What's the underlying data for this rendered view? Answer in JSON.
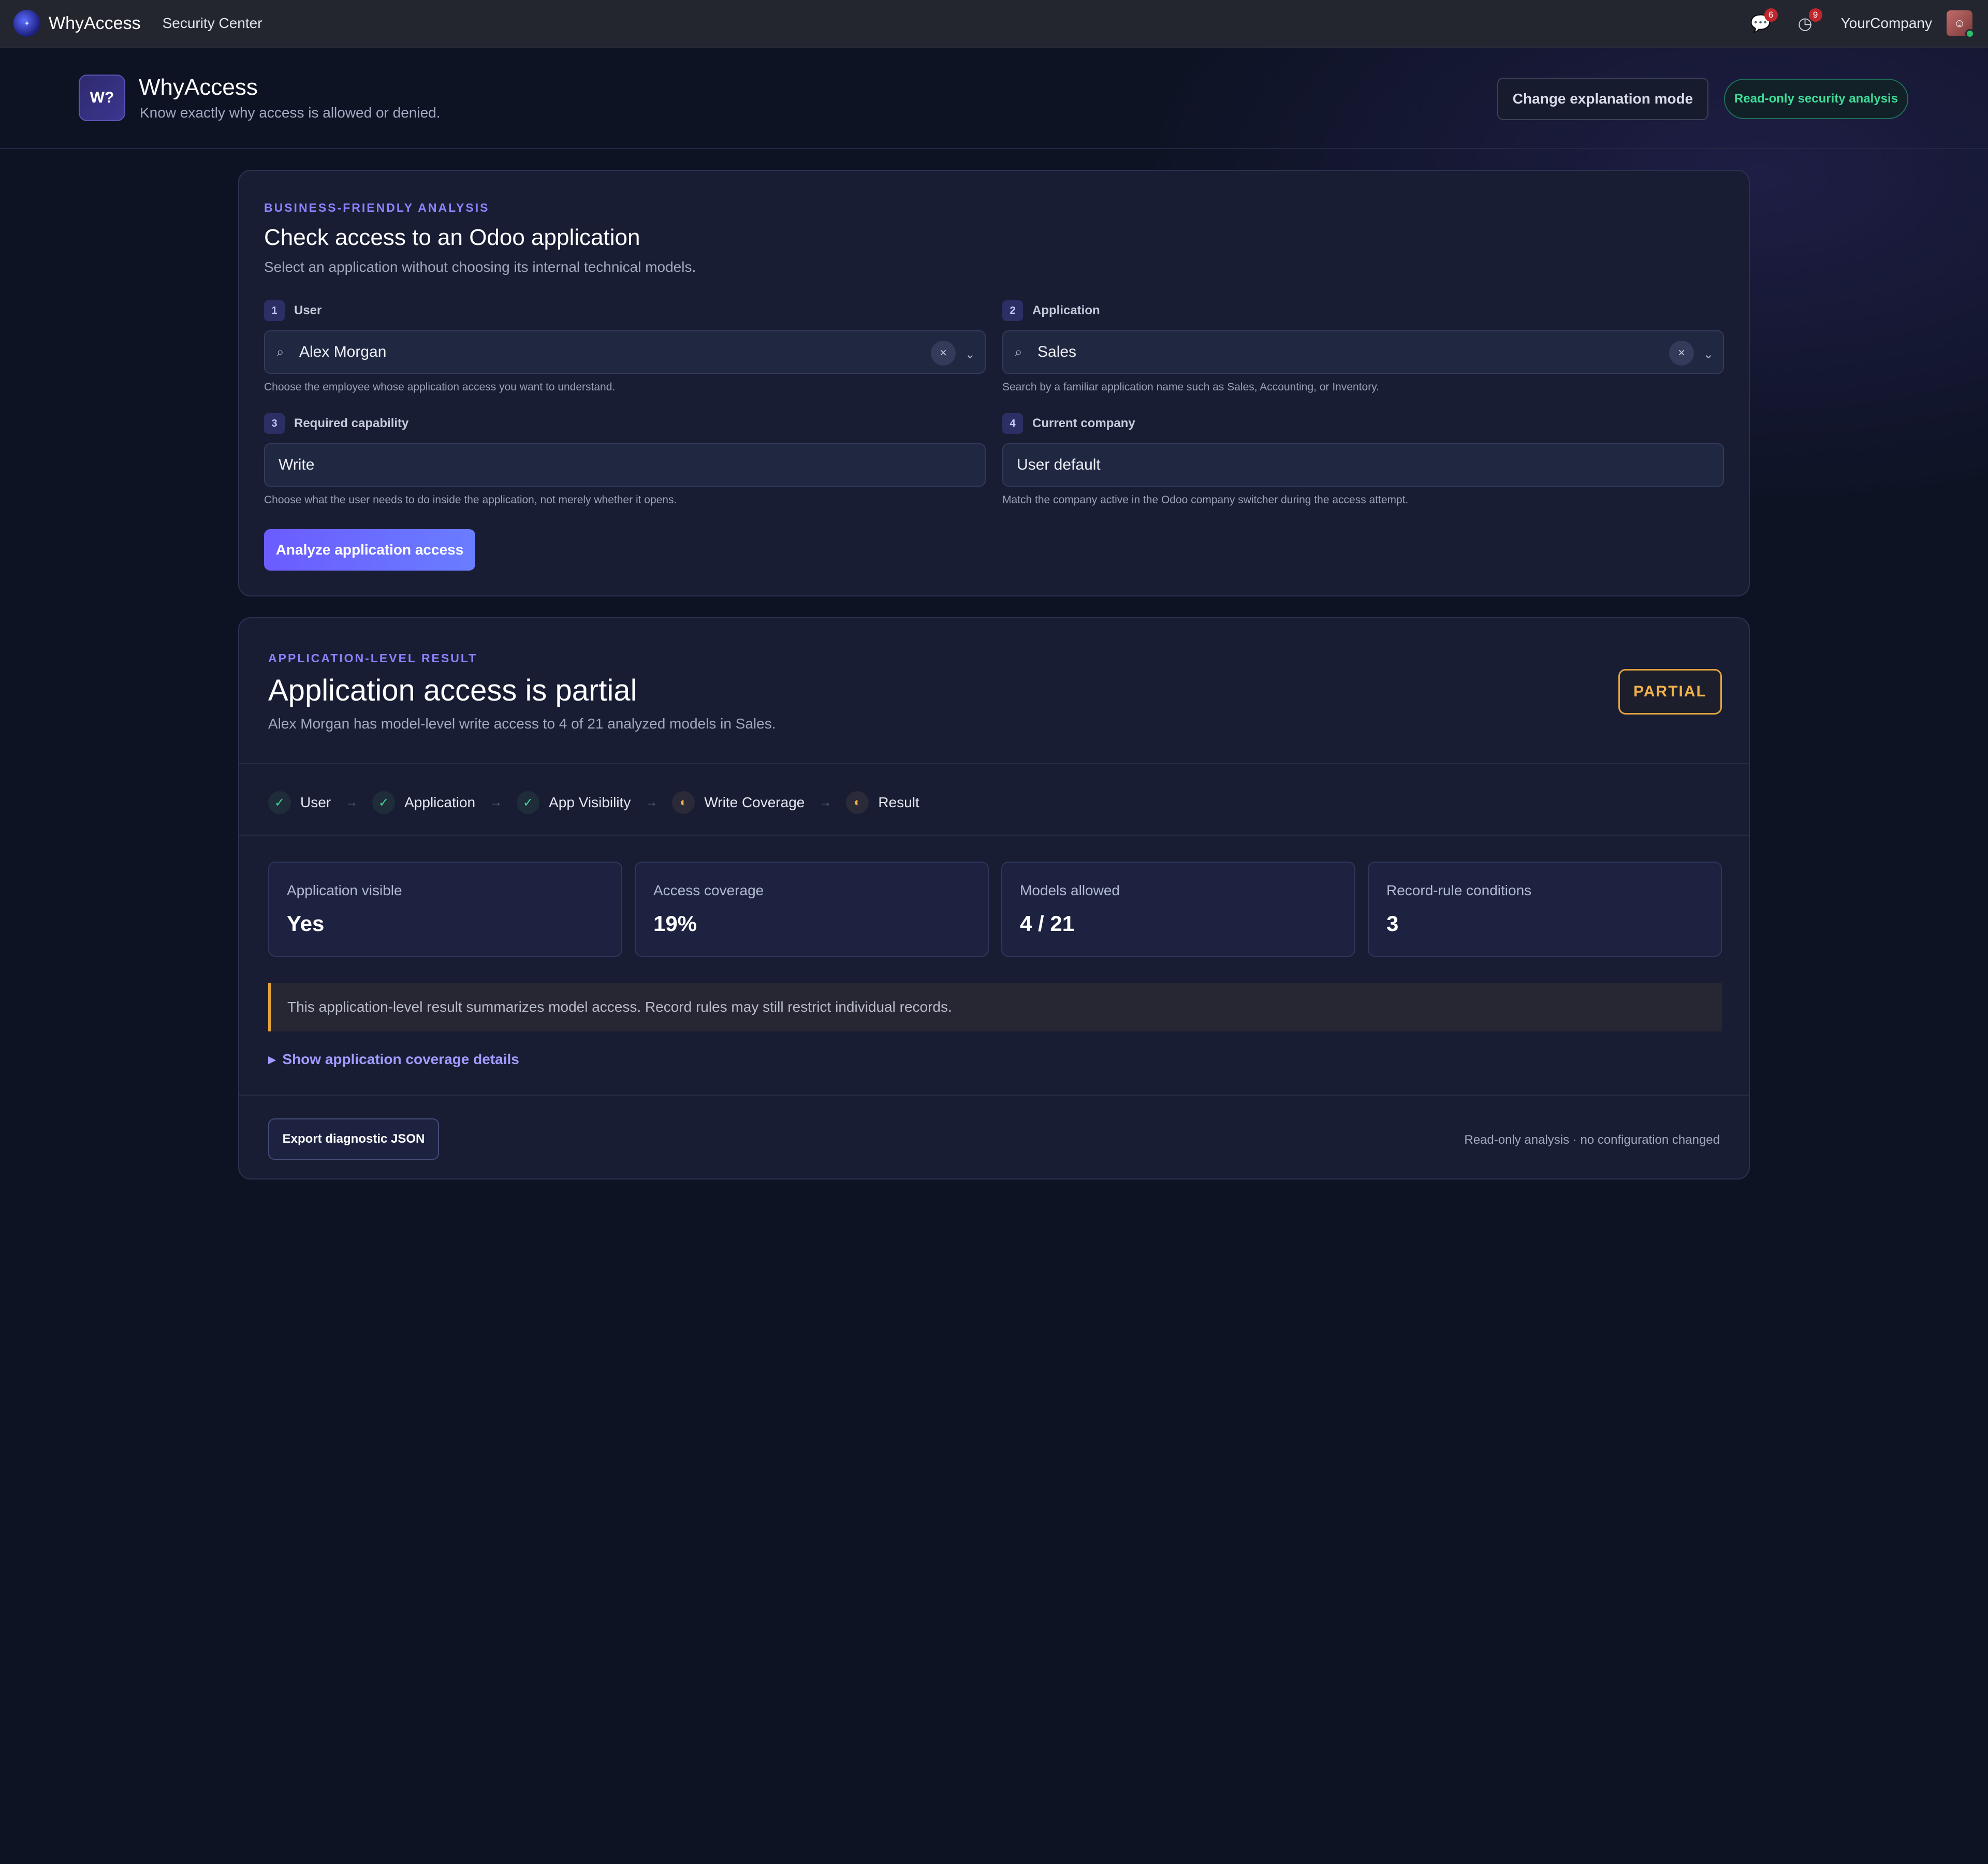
{
  "navbar": {
    "brand": "WhyAccess",
    "menu_item": "Security Center",
    "messages_count": "6",
    "activities_count": "9",
    "company": "YourCompany"
  },
  "header": {
    "logo_text": "W?",
    "title": "WhyAccess",
    "subtitle": "Know exactly why access is allowed or denied.",
    "mode_button": "Change explanation mode",
    "readonly_badge": "Read-only security analysis"
  },
  "form": {
    "eyebrow": "BUSINESS-FRIENDLY ANALYSIS",
    "title": "Check access to an Odoo application",
    "subtitle": "Select an application without choosing its internal technical models.",
    "fields": [
      {
        "step": "1",
        "label": "User",
        "value": "Alex Morgan",
        "help": "Choose the employee whose application access you want to understand."
      },
      {
        "step": "2",
        "label": "Application",
        "value": "Sales",
        "help": "Search by a familiar application name such as Sales, Accounting, or Inventory."
      },
      {
        "step": "3",
        "label": "Required capability",
        "value": "Write",
        "help": "Choose what the user needs to do inside the application, not merely whether it opens."
      },
      {
        "step": "4",
        "label": "Current company",
        "value": "User default",
        "help": "Match the company active in the Odoo company switcher during the access attempt."
      }
    ],
    "analyze_button": "Analyze application access"
  },
  "result": {
    "eyebrow": "APPLICATION-LEVEL RESULT",
    "title": "Application access is partial",
    "subtitle": "Alex Morgan has model-level write access to 4 of 21 analyzed models in Sales.",
    "status_badge": "PARTIAL",
    "flow": [
      {
        "label": "User",
        "state": "ok",
        "icon": "check-icon"
      },
      {
        "label": "Application",
        "state": "ok",
        "icon": "check-icon"
      },
      {
        "label": "App Visibility",
        "state": "ok",
        "icon": "check-icon"
      },
      {
        "label": "Write Coverage",
        "state": "partial",
        "icon": "half-circle-icon"
      },
      {
        "label": "Result",
        "state": "partial",
        "icon": "half-circle-icon"
      }
    ],
    "metrics": [
      {
        "label": "Application visible",
        "value": "Yes"
      },
      {
        "label": "Access coverage",
        "value": "19%"
      },
      {
        "label": "Models allowed",
        "value": "4 / 21"
      },
      {
        "label": "Record-rule conditions",
        "value": "3"
      }
    ],
    "notice": "This application-level result summarizes model access. Record rules may still restrict individual records.",
    "details_toggle": "Show application coverage details",
    "export_button": "Export diagnostic JSON",
    "footer_note": "Read-only analysis · no configuration changed"
  },
  "colors": {
    "accent": "#6b5cff",
    "success": "#3ddc97",
    "warning": "#f0b24a",
    "background": "#0e1324",
    "card": "#181d33"
  }
}
